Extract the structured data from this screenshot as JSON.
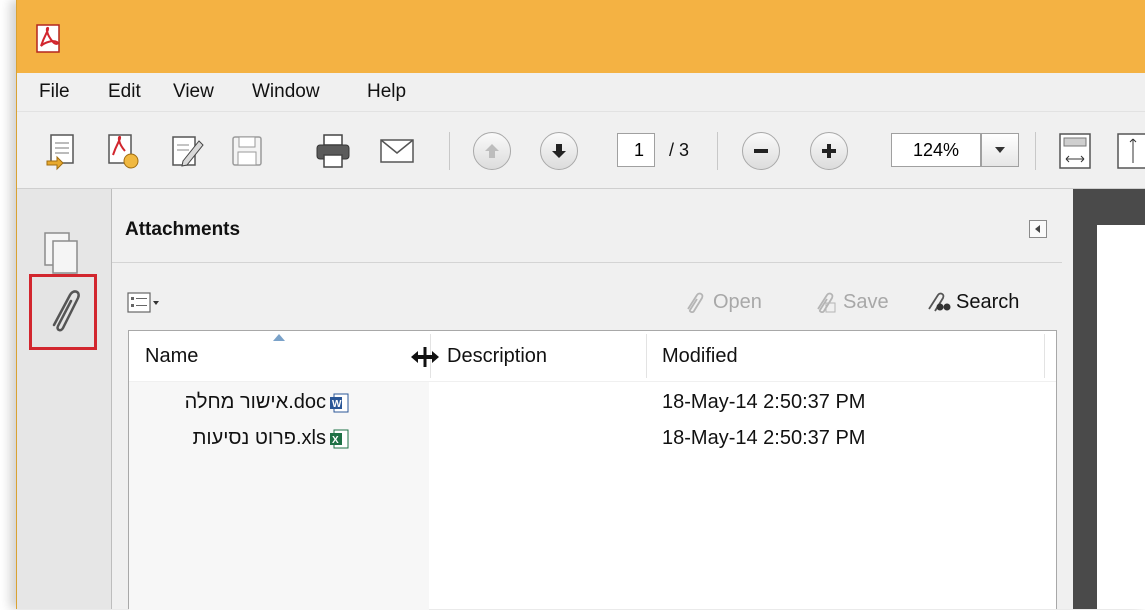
{
  "menubar": {
    "items": [
      "File",
      "Edit",
      "View",
      "Window",
      "Help"
    ]
  },
  "toolbar": {
    "current_page": "1",
    "page_total": "/ 3",
    "zoom": "124%",
    "buttons": [
      "create-pdf-icon",
      "open-file-icon",
      "edit-icon",
      "save-icon",
      "print-icon",
      "email-icon",
      "previous-page-icon",
      "next-page-icon",
      "zoom-out-icon",
      "zoom-in-icon",
      "fit-page-icon",
      "fit-width-icon"
    ]
  },
  "left_rail": {
    "items": [
      "pages-icon",
      "attachments-icon"
    ]
  },
  "attachments_panel": {
    "title": "Attachments",
    "actions": {
      "open": "Open",
      "save": "Save",
      "search": "Search"
    },
    "columns": {
      "name": "Name",
      "description": "Description",
      "modified": "Modified"
    },
    "files": [
      {
        "name": "אישור מחלה.doc",
        "description": "",
        "modified": "18-May-14 2:50:37 PM",
        "icon": "word-doc-icon"
      },
      {
        "name": "פרוט נסיעות.xls",
        "description": "",
        "modified": "18-May-14 2:50:37 PM",
        "icon": "excel-xls-icon"
      }
    ]
  },
  "colors": {
    "titlebar": "#f4b243",
    "highlight": "#d2262e"
  }
}
